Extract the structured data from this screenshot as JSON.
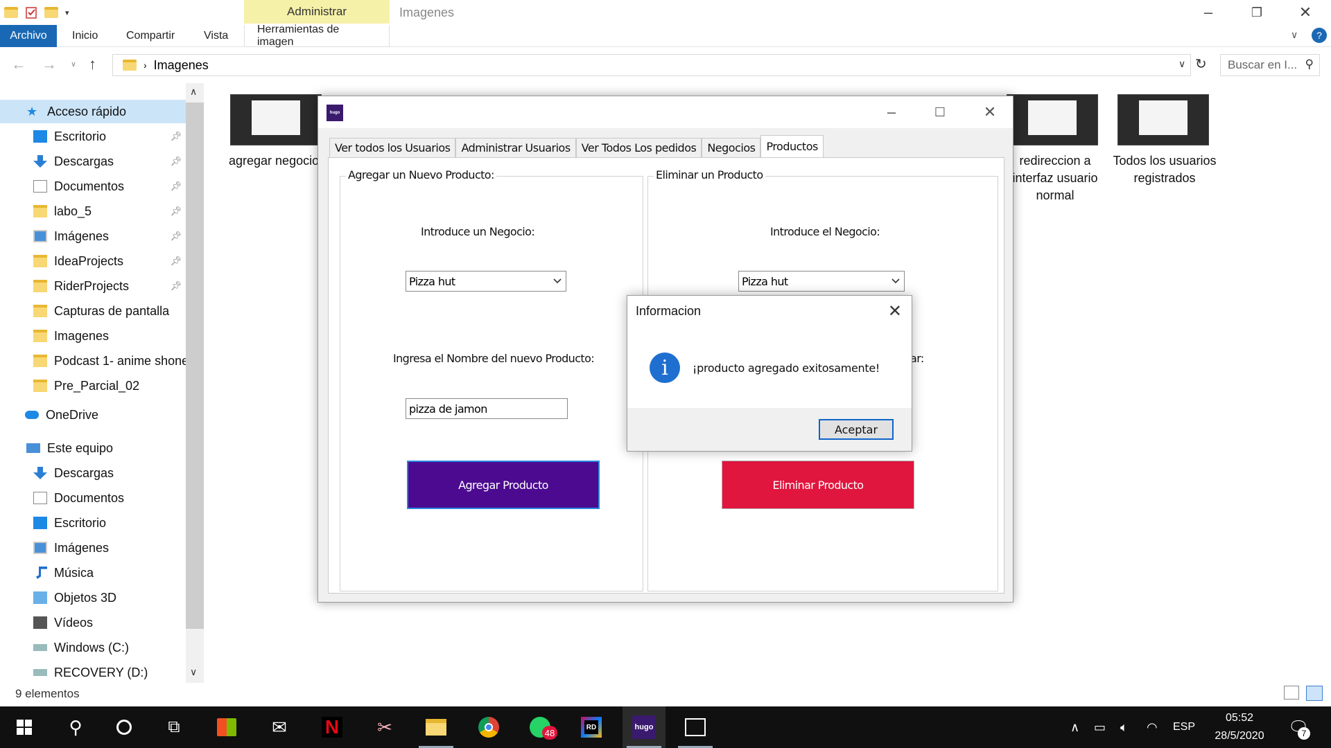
{
  "explorer": {
    "window_title": "Imagenes",
    "contextual_tab_header": "Administrar",
    "ribbon_tabs": [
      "Archivo",
      "Inicio",
      "Compartir",
      "Vista",
      "Herramientas de imagen"
    ],
    "address_path": "Imagenes",
    "search_placeholder": "Buscar en I...",
    "status_count": "9 elementos"
  },
  "sidebar": {
    "quick_access": "Acceso rápido",
    "items": [
      {
        "label": "Escritorio",
        "icon": "desktop-icon",
        "pinned": true
      },
      {
        "label": "Descargas",
        "icon": "download-icon",
        "pinned": true
      },
      {
        "label": "Documentos",
        "icon": "document-icon",
        "pinned": true
      },
      {
        "label": "labo_5",
        "icon": "folder-icon",
        "pinned": true
      },
      {
        "label": "Imágenes",
        "icon": "pictures-icon",
        "pinned": true
      },
      {
        "label": "IdeaProjects",
        "icon": "folder-icon",
        "pinned": true
      },
      {
        "label": "RiderProjects",
        "icon": "folder-icon",
        "pinned": true
      },
      {
        "label": "Capturas de pantalla",
        "icon": "folder-icon",
        "pinned": false
      },
      {
        "label": "Imagenes",
        "icon": "folder-icon",
        "pinned": false
      },
      {
        "label": "Podcast 1- anime shone",
        "icon": "folder-icon",
        "pinned": false
      },
      {
        "label": "Pre_Parcial_02",
        "icon": "folder-icon",
        "pinned": false
      }
    ],
    "onedrive": "OneDrive",
    "this_pc": "Este equipo",
    "pc_items": [
      {
        "label": "Descargas",
        "icon": "download-icon"
      },
      {
        "label": "Documentos",
        "icon": "document-icon"
      },
      {
        "label": "Escritorio",
        "icon": "desktop-icon"
      },
      {
        "label": "Imágenes",
        "icon": "pictures-icon"
      },
      {
        "label": "Música",
        "icon": "music-icon"
      },
      {
        "label": "Objetos 3D",
        "icon": "3d-objects-icon"
      },
      {
        "label": "Vídeos",
        "icon": "videos-icon"
      },
      {
        "label": "Windows (C:)",
        "icon": "drive-icon"
      },
      {
        "label": "RECOVERY (D:)",
        "icon": "drive-icon"
      }
    ]
  },
  "files": {
    "first_label": "agregar negocio",
    "right_labels": [
      "redireccion a interfaz usuario normal",
      "Todos los usuarios registrados"
    ]
  },
  "app": {
    "logo_text": "hugo",
    "tabs": [
      "Ver todos los Usuarios",
      "Administrar Usuarios",
      "Ver Todos Los pedidos",
      "Negocios",
      "Productos"
    ],
    "active_tab": "Productos",
    "add_group": {
      "title": "Agregar un Nuevo Producto:",
      "business_label": "Introduce un Negocio:",
      "business_value": "Pizza hut",
      "name_label": "Ingresa el Nombre del nuevo Producto:",
      "name_value": "pizza de jamon",
      "button": "Agregar Producto"
    },
    "delete_group": {
      "title": "Eliminar un Producto",
      "business_label": "Introduce el Negocio:",
      "business_value": "Pizza hut",
      "partial_label": "ar:",
      "button": "Eliminar Producto"
    }
  },
  "dialog": {
    "title": "Informacion",
    "message": "¡producto agregado exitosamente!",
    "ok_button": "Aceptar"
  },
  "taskbar": {
    "whatsapp_badge": "48",
    "hugo_label": "hugo",
    "language": "ESP",
    "time": "05:52",
    "date": "28/5/2020",
    "notifications": "7"
  },
  "colors": {
    "add_button": "#4b0a8f",
    "delete_button": "#e0163e",
    "ribbon_accent": "#1a68b3",
    "contextual_tab": "#f5f1a8"
  }
}
